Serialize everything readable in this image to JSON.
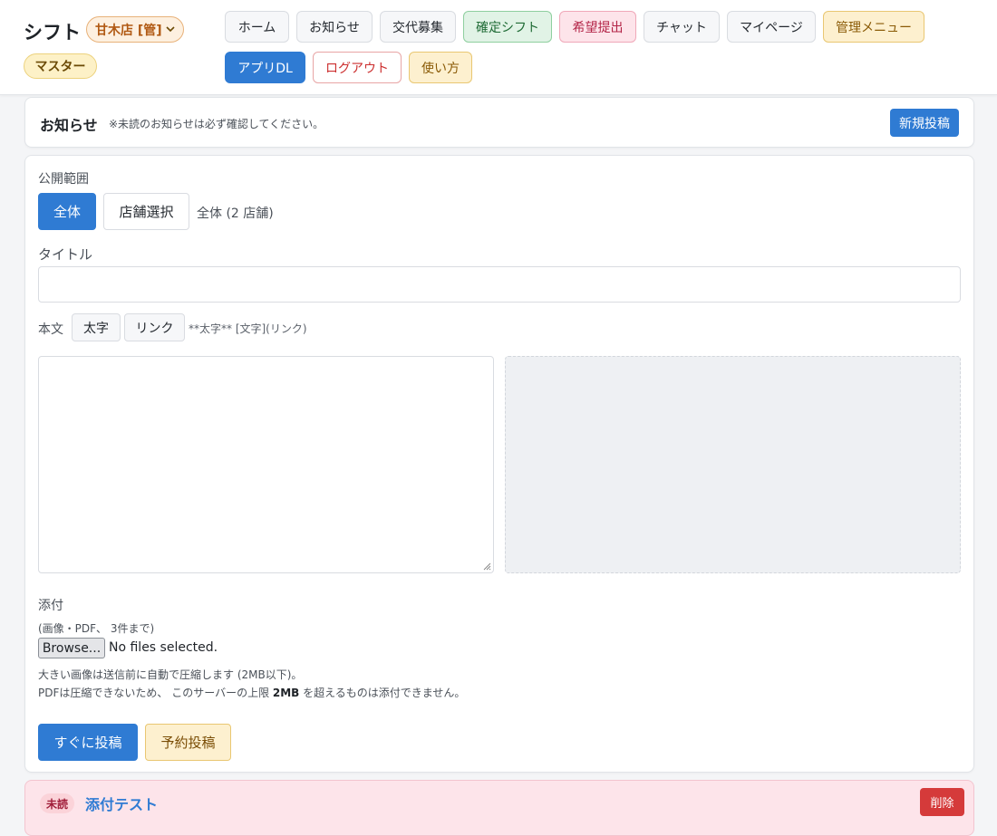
{
  "header": {
    "app_title": "シフト",
    "store_selector": "甘木店 [管]",
    "role_badge": "マスター",
    "nav": [
      {
        "label": "ホーム",
        "style": "default"
      },
      {
        "label": "お知らせ",
        "style": "default"
      },
      {
        "label": "交代募集",
        "style": "default"
      },
      {
        "label": "確定シフト",
        "style": "green"
      },
      {
        "label": "希望提出",
        "style": "pink"
      },
      {
        "label": "チャット",
        "style": "default"
      },
      {
        "label": "マイページ",
        "style": "default"
      },
      {
        "label": "管理メニュー",
        "style": "amber"
      },
      {
        "label": "アプリDL",
        "style": "blue"
      },
      {
        "label": "ログアウト",
        "style": "red-outline"
      },
      {
        "label": "使い方",
        "style": "amber"
      }
    ]
  },
  "notice_section": {
    "title": "お知らせ",
    "note": "※未読のお知らせは必ず確認してください。",
    "new_post_button": "新規投稿"
  },
  "form": {
    "scope_label": "公開範囲",
    "scope_options": [
      "全体",
      "店舗選択"
    ],
    "scope_selected": "全体",
    "scope_status": "全体 (2 店舗)",
    "title_label": "タイトル",
    "title_value": "",
    "body_label": "本文",
    "format_buttons": [
      "太字",
      "リンク"
    ],
    "format_hint": "**太字** [文字](リンク)",
    "body_value": "",
    "attach_label": "添付",
    "attach_hint": "(画像・PDF、 3件まで)",
    "file_button": "Browse...",
    "file_status": "No files selected.",
    "compress_note": "大きい画像は送信前に自動で圧縮します (2MB以下)。",
    "pdf_note_before": "PDFは圧縮できないため、 このサーバーの上限 ",
    "pdf_note_limit": "2MB",
    "pdf_note_after": " を超えるものは添付できません。",
    "post_now_button": "すぐに投稿",
    "schedule_button": "予約投稿"
  },
  "posts": [
    {
      "badge": "未読",
      "title": "添付テスト",
      "delete_button": "削除"
    }
  ],
  "colors": {
    "primary": "#2f7bd3",
    "unread_bg": "#fde4ea",
    "danger": "#d53a3a"
  }
}
